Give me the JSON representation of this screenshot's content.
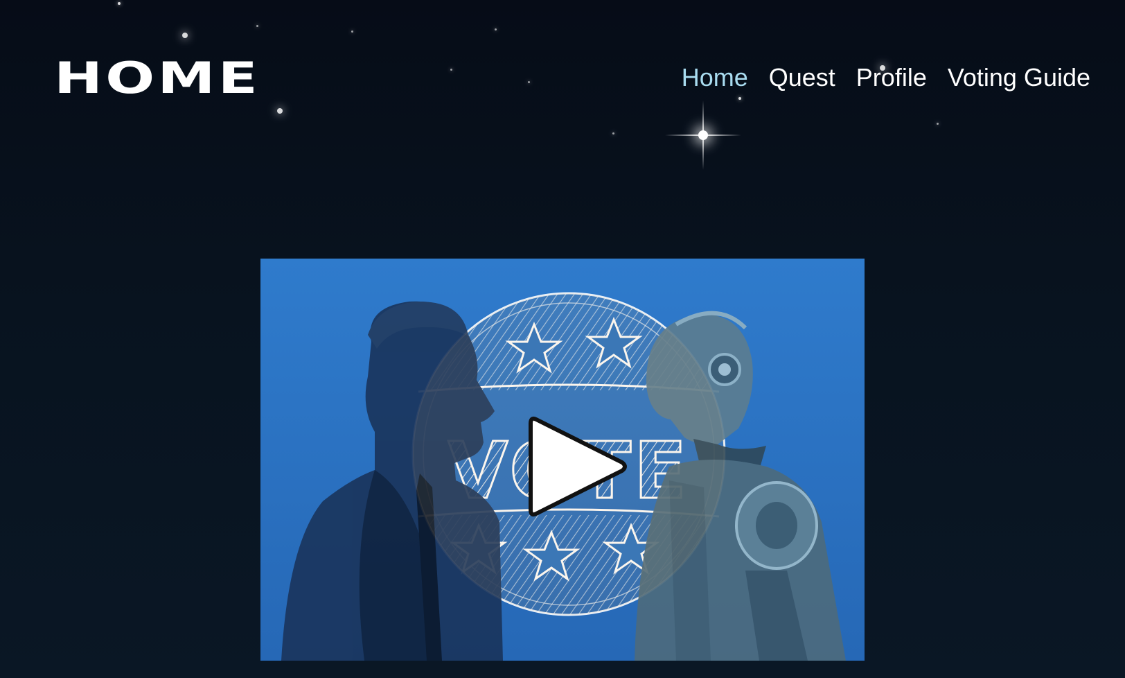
{
  "logo": {
    "text": "HOME"
  },
  "nav": {
    "items": [
      {
        "label": "Home",
        "active": true
      },
      {
        "label": "Quest",
        "active": false
      },
      {
        "label": "Profile",
        "active": false
      },
      {
        "label": "Voting Guide",
        "active": false
      }
    ]
  },
  "video": {
    "icon": "play-icon",
    "badge_text": "VOTE"
  },
  "colors": {
    "background": "#07101c",
    "nav_text": "#ffffff",
    "nav_active": "#a9dcf0",
    "video_bg": "#2a73c2"
  }
}
